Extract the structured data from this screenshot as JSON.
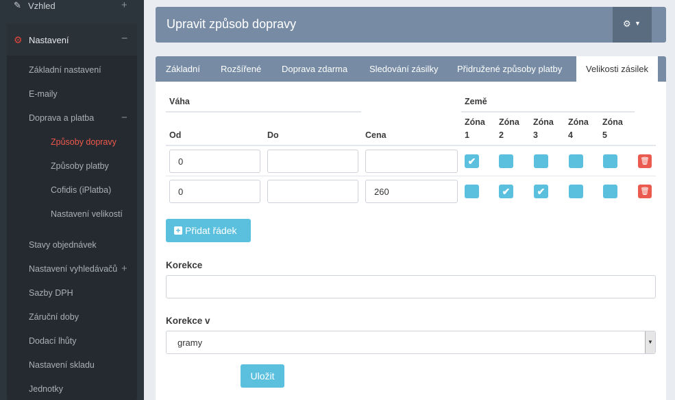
{
  "sidebar": {
    "top_item": {
      "label": "Vzhled",
      "expander": "+"
    },
    "section": {
      "label": "Nastavení",
      "expander": "−"
    },
    "items": [
      {
        "label": "Základní nastavení"
      },
      {
        "label": "E-maily"
      },
      {
        "label": "Doprava a platba",
        "expander": "−"
      },
      {
        "label": "Stavy objednávek"
      },
      {
        "label": "Nastavení vyhledávačů",
        "expander": "+"
      },
      {
        "label": "Sazby DPH"
      },
      {
        "label": "Záruční doby"
      },
      {
        "label": "Dodací lhůty"
      },
      {
        "label": "Nastavení skladu"
      },
      {
        "label": "Jednotky"
      }
    ],
    "subitems": [
      {
        "label": "Způsoby dopravy",
        "active": true
      },
      {
        "label": "Způsoby platby"
      },
      {
        "label": "Cofidis (iPlatba)"
      },
      {
        "label": "Nastavení velikostí"
      }
    ]
  },
  "header": {
    "title": "Upravit způsob dopravy",
    "tools_icon": "gears-icon"
  },
  "tabs": [
    {
      "label": "Základní"
    },
    {
      "label": "Rozšířené"
    },
    {
      "label": "Doprava zdarma"
    },
    {
      "label": "Sledování zásilky"
    },
    {
      "label": "Přidružené způsoby platby"
    },
    {
      "label": "Velikosti zásilek",
      "active": true
    }
  ],
  "table": {
    "group_weight": "Váha",
    "group_country": "Země",
    "col_from": "Od",
    "col_to": "Do",
    "col_price": "Cena",
    "zones": [
      {
        "line1": "Zóna",
        "line2": "1"
      },
      {
        "line1": "Zóna",
        "line2": "2"
      },
      {
        "line1": "Zóna",
        "line2": "3"
      },
      {
        "line1": "Zóna",
        "line2": "4"
      },
      {
        "line1": "Zóna",
        "line2": "5"
      }
    ],
    "rows": [
      {
        "from": "0",
        "to": "",
        "price": "",
        "zones": [
          true,
          false,
          false,
          false,
          false
        ]
      },
      {
        "from": "0",
        "to": "",
        "price": "260",
        "zones": [
          false,
          true,
          true,
          false,
          false
        ]
      }
    ]
  },
  "add_row_label": "Přidat řádek",
  "correction": {
    "label": "Korekce",
    "value": ""
  },
  "correction_unit": {
    "label": "Korekce v",
    "selected": "gramy"
  },
  "save_label": "Uložit",
  "colors": {
    "accent": "#5bc0de",
    "header": "#778ca4",
    "danger": "#ea5a4f",
    "active_menu": "#f0584b"
  }
}
